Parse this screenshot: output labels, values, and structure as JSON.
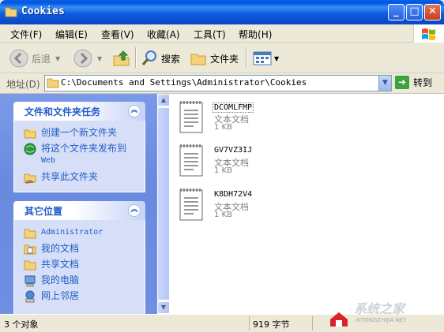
{
  "window": {
    "title": "Cookies",
    "minimize": "_",
    "maximize": "□",
    "close": "✕"
  },
  "menu": [
    {
      "label": "文件",
      "key": "(F)"
    },
    {
      "label": "编辑",
      "key": "(E)"
    },
    {
      "label": "查看",
      "key": "(V)"
    },
    {
      "label": "收藏",
      "key": "(A)"
    },
    {
      "label": "工具",
      "key": "(T)"
    },
    {
      "label": "帮助",
      "key": "(H)"
    }
  ],
  "toolbar": {
    "back_label": "后退",
    "search_label": "搜索",
    "folders_label": "文件夹"
  },
  "address": {
    "label": "地址(D)",
    "path": "C:\\Documents and Settings\\Administrator\\Cookies",
    "go_label": "转到"
  },
  "tasks_panel": {
    "title": "文件和文件夹任务",
    "items": [
      {
        "label": "创建一个新文件夹",
        "icon": "new-folder-icon"
      },
      {
        "label": "将这个文件夹发布到",
        "label2": "Web",
        "icon": "publish-web-icon"
      },
      {
        "label": "共享此文件夹",
        "icon": "share-folder-icon"
      }
    ]
  },
  "places_panel": {
    "title": "其它位置",
    "items": [
      {
        "label": "Administrator",
        "icon": "folder-icon"
      },
      {
        "label": "我的文档",
        "icon": "my-documents-icon"
      },
      {
        "label": "共享文档",
        "icon": "shared-documents-icon"
      },
      {
        "label": "我的电脑",
        "icon": "my-computer-icon"
      },
      {
        "label": "网上邻居",
        "icon": "network-places-icon"
      }
    ]
  },
  "files": [
    {
      "name": "DCOMLFMP",
      "type": "文本文档",
      "size": "1 KB"
    },
    {
      "name": "GV7VZ3IJ",
      "type": "文本文档",
      "size": "1 KB"
    },
    {
      "name": "K8DH72V4",
      "type": "文本文档",
      "size": "1 KB"
    }
  ],
  "status": {
    "count": "3 个对象",
    "size": "919 字节",
    "zone": "系统之家",
    "brand": "XITONGZHIJIA.NET"
  },
  "colors": {
    "title_bar": "#0a5fe6",
    "task_link": "#215dc6",
    "left_pane": "#7a9ae8"
  }
}
